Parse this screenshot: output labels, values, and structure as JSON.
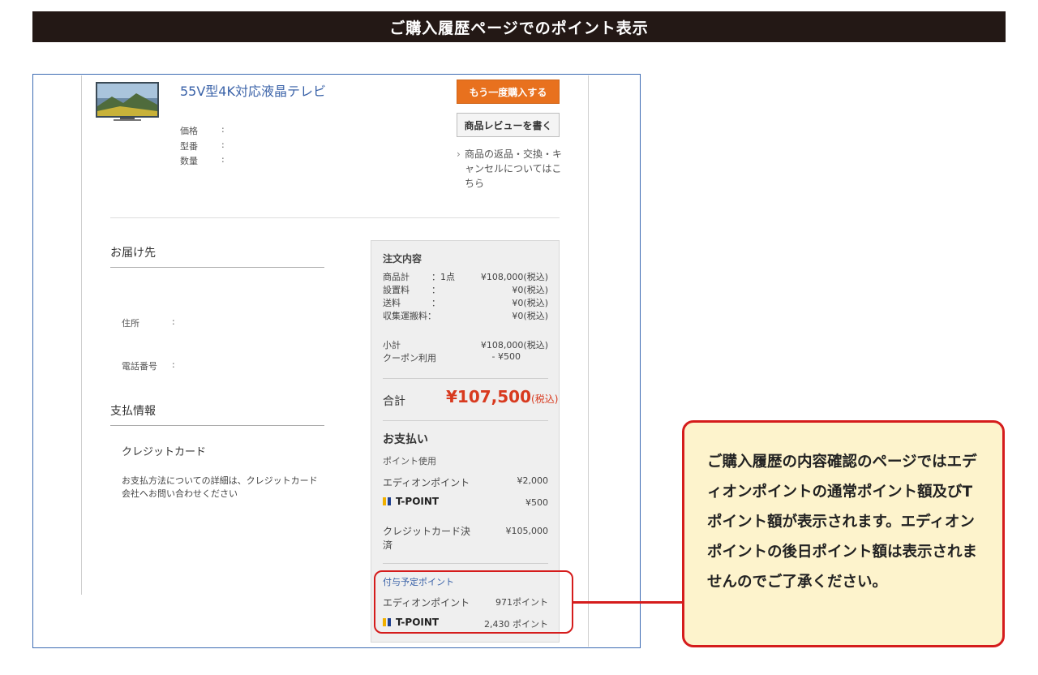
{
  "header": {
    "title": "ご購入履歴ページでのポイント表示"
  },
  "product": {
    "name": "55V型4K対応液晶テレビ",
    "fields": [
      "価格",
      "型番",
      "数量"
    ],
    "colon": ":",
    "rebuy_button": "もう一度購入する",
    "review_button": "商品レビューを書く",
    "return_link": "商品の返品・交換・キャンセルについてはこちら"
  },
  "delivery": {
    "title": "お届け先",
    "address_label": "住所",
    "phone_label": "電話番号",
    "colon": ":"
  },
  "payment_info": {
    "title": "支払情報",
    "method": "クレジットカード",
    "note": "お支払方法についての詳細は、クレジットカード会社へお問い合わせください"
  },
  "order_summary": {
    "title": "注文内容",
    "rows": [
      {
        "label": "商品計",
        "mid": "：1点",
        "value": "¥108,000(税込)"
      },
      {
        "label": "設置料",
        "mid": "：",
        "value": "¥0(税込)"
      },
      {
        "label": "送料",
        "mid": "：",
        "value": "¥0(税込)"
      },
      {
        "label": "収集運搬料：",
        "mid": "",
        "value": "¥0(税込)"
      }
    ],
    "subtotal_label": "小計",
    "subtotal_value": "¥108,000(税込)",
    "coupon_label": "クーポン利用",
    "coupon_value": "- ¥500",
    "total_label": "合計",
    "total_value": "¥107,500",
    "total_tax": "(税込)"
  },
  "payment": {
    "title": "お支払い",
    "point_use_label": "ポイント使用",
    "edion_label": "エディオンポイント",
    "edion_value": "¥2,000",
    "tpoint_label": "T-POINT",
    "tpoint_value": "¥500",
    "card_label": "クレジットカード決済",
    "card_value": "¥105,000"
  },
  "scheduled_points": {
    "title": "付与予定ポイント",
    "edion_label": "エディオンポイント",
    "edion_value": "971ポイント",
    "tpoint_label": "T-POINT",
    "tpoint_value": "2,430 ポイント"
  },
  "callout": {
    "text": "ご購入履歴の内容確認のページではエディオンポイントの通常ポイント額及びTポイント額が表示されます。エディオンポイントの後日ポイント額は表示されませんのでご了承ください。"
  },
  "colors": {
    "accent_orange": "#e8711e",
    "alert_red": "#d51c1c",
    "total_red": "#d83a1f",
    "link_blue": "#3a62a8",
    "callout_bg": "#fdf3cc"
  }
}
